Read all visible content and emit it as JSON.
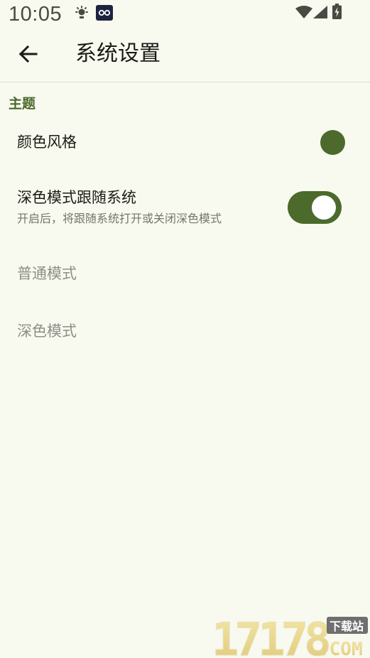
{
  "status_bar": {
    "time": "10:05"
  },
  "app_bar": {
    "title": "系统设置"
  },
  "theme_section": {
    "header": "主题",
    "color_style": {
      "label": "颜色风格",
      "color": "#4b6a2b"
    },
    "follow_system_dark": {
      "label": "深色模式跟随系统",
      "description": "开启后，将跟随系统打开或关闭深色模式",
      "enabled": true
    },
    "normal_mode": {
      "label": "普通模式"
    },
    "dark_mode": {
      "label": "深色模式"
    }
  },
  "watermark": {
    "number": "17178",
    "tag": "下载站",
    "domain": ".COM"
  },
  "colors": {
    "background": "#f8f9ef",
    "accent": "#4b6a2b",
    "disabled_text": "#8e8f88"
  }
}
